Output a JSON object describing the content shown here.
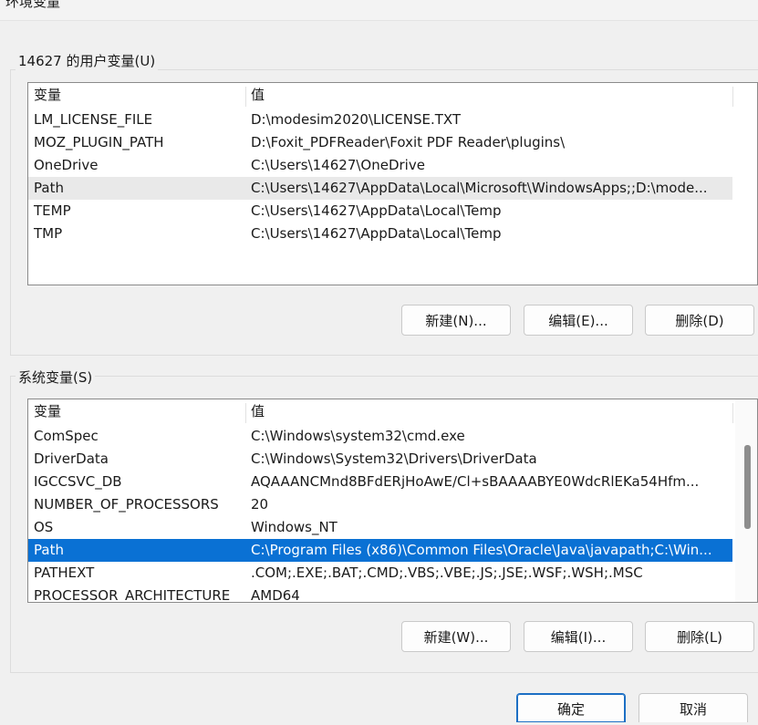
{
  "window": {
    "title": "环境变量"
  },
  "user_vars": {
    "group_label": "14627 的用户变量(U)",
    "columns": {
      "name": "变量",
      "value": "值"
    },
    "rows": [
      {
        "name": "LM_LICENSE_FILE",
        "value": "D:\\modesim2020\\LICENSE.TXT"
      },
      {
        "name": "MOZ_PLUGIN_PATH",
        "value": "D:\\Foxit_PDFReader\\Foxit PDF Reader\\plugins\\"
      },
      {
        "name": "OneDrive",
        "value": "C:\\Users\\14627\\OneDrive"
      },
      {
        "name": "Path",
        "value": "C:\\Users\\14627\\AppData\\Local\\Microsoft\\WindowsApps;;D:\\mode..."
      },
      {
        "name": "TEMP",
        "value": "C:\\Users\\14627\\AppData\\Local\\Temp"
      },
      {
        "name": "TMP",
        "value": "C:\\Users\\14627\\AppData\\Local\\Temp"
      }
    ],
    "buttons": {
      "new": "新建(N)...",
      "edit": "编辑(E)...",
      "delete": "删除(D)"
    }
  },
  "system_vars": {
    "group_label": "系统变量(S)",
    "columns": {
      "name": "变量",
      "value": "值"
    },
    "rows": [
      {
        "name": "ComSpec",
        "value": "C:\\Windows\\system32\\cmd.exe"
      },
      {
        "name": "DriverData",
        "value": "C:\\Windows\\System32\\Drivers\\DriverData"
      },
      {
        "name": "IGCCSVC_DB",
        "value": "AQAAANCMnd8BFdERjHoAwE/Cl+sBAAAABYE0WdcRlEKa54Hfm..."
      },
      {
        "name": "NUMBER_OF_PROCESSORS",
        "value": "20"
      },
      {
        "name": "OS",
        "value": "Windows_NT"
      },
      {
        "name": "Path",
        "value": "C:\\Program Files (x86)\\Common Files\\Oracle\\Java\\javapath;C:\\Win..."
      },
      {
        "name": "PATHEXT",
        "value": ".COM;.EXE;.BAT;.CMD;.VBS;.VBE;.JS;.JSE;.WSF;.WSH;.MSC"
      },
      {
        "name": "PROCESSOR_ARCHITECTURE",
        "value": "AMD64"
      }
    ],
    "buttons": {
      "new": "新建(W)...",
      "edit": "编辑(I)...",
      "delete": "删除(L)"
    }
  },
  "footer": {
    "ok": "确定",
    "cancel": "取消"
  },
  "colors": {
    "selection_blue": "#0a71d4",
    "selection_gray": "#e9e9e9",
    "accent_border": "#1c6fc4"
  }
}
